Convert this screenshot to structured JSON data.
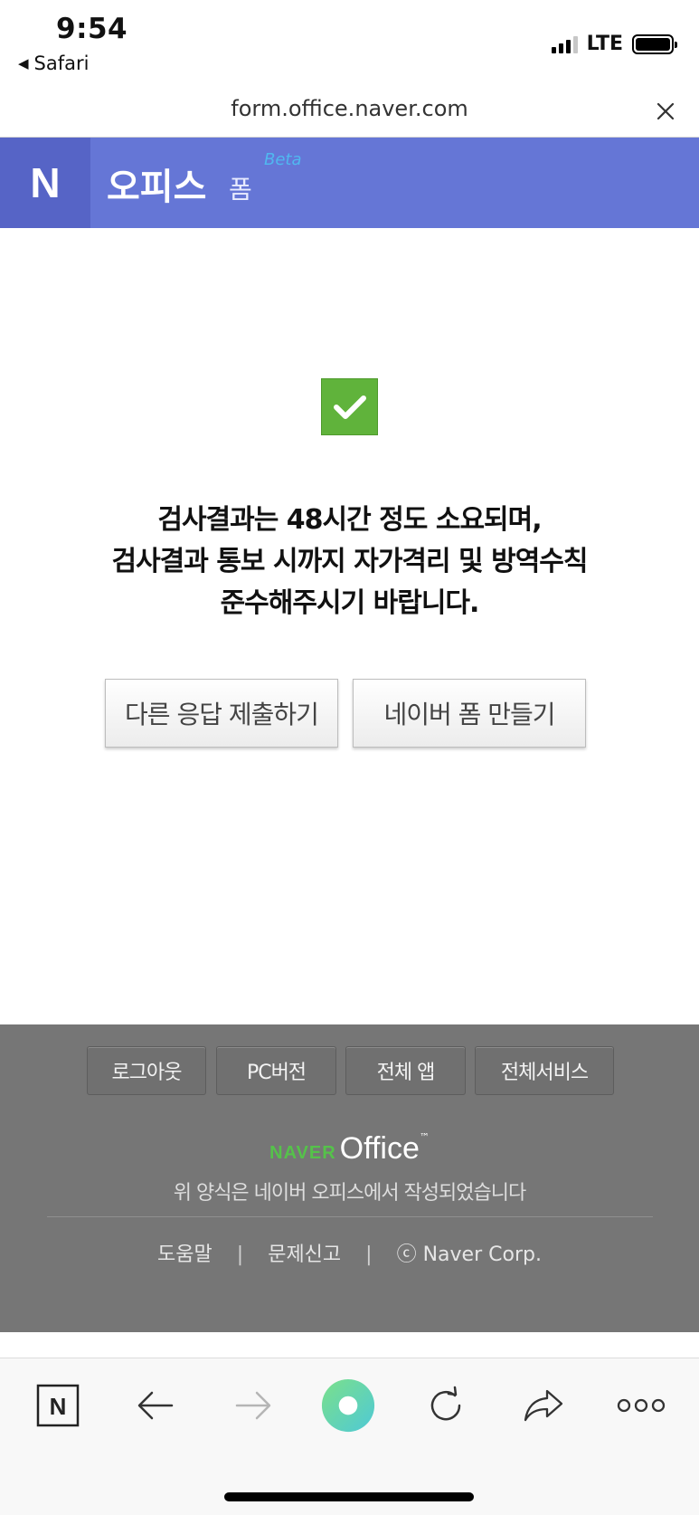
{
  "status": {
    "time": "9:54",
    "back_app": "Safari",
    "network": "LTE"
  },
  "browser": {
    "url": "form.office.naver.com"
  },
  "header": {
    "logo": "N",
    "title": "오피스",
    "subtitle": "폼",
    "badge": "Beta"
  },
  "main": {
    "message_lines": [
      "검사결과는 48시간 정도 소요되며,",
      "검사결과 통보 시까지 자가격리 및 방역수칙",
      "준수해주시기 바랍니다."
    ],
    "buttons": {
      "resubmit": "다른 응답 제출하기",
      "create_form": "네이버 폼 만들기"
    }
  },
  "footer": {
    "buttons": [
      "로그아웃",
      "PC버전",
      "전체 앱",
      "전체서비스"
    ],
    "brand_naver": "NAVER",
    "brand_office": "Office",
    "brand_tm": "™",
    "note": "위 양식은 네이버 오피스에서 작성되었습니다",
    "links": [
      "도움말",
      "문제신고",
      "ⓒ Naver Corp."
    ],
    "link_separator": "|"
  },
  "toolbar": {
    "n_logo": "N"
  },
  "colors": {
    "header_bg": "#6576d6",
    "logo_bg": "#5664c6",
    "check_green": "#60b33b",
    "footer_bg": "#767676",
    "brand_green": "#55c24a",
    "home_gradient_start": "#7be08a",
    "home_gradient_end": "#4fc9d6"
  },
  "icons": {
    "check": "check-icon",
    "close": "close-icon",
    "back": "arrow-left-icon",
    "forward": "arrow-right-icon",
    "reload": "reload-icon",
    "share": "share-icon",
    "more": "more-icon",
    "home": "home-dot-icon"
  }
}
